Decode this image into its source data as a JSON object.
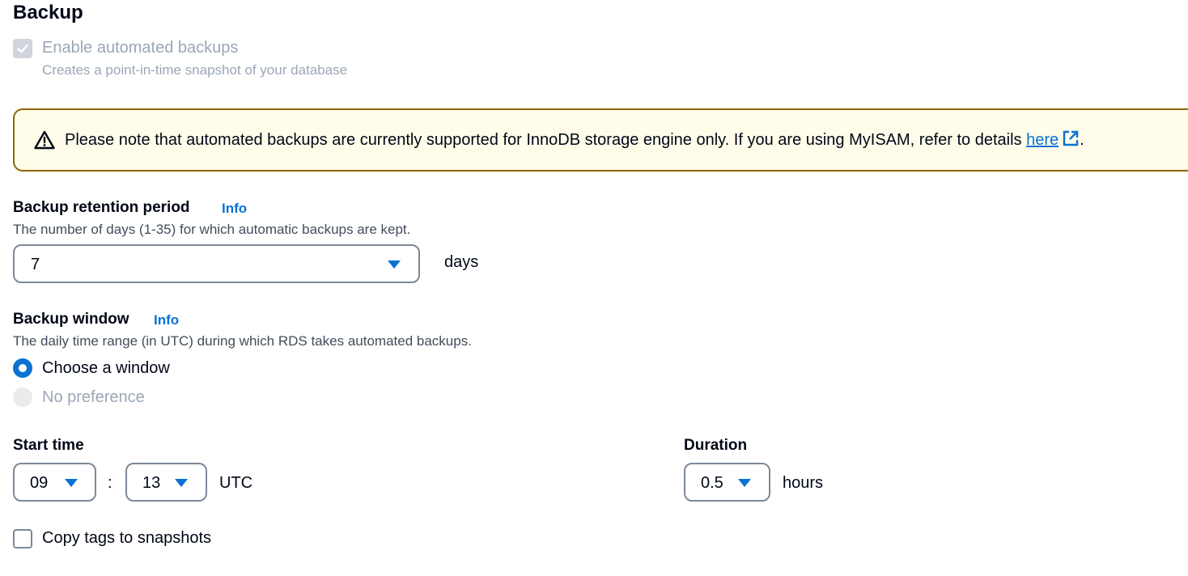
{
  "section": {
    "title": "Backup"
  },
  "automated_backups": {
    "label": "Enable automated backups",
    "description": "Creates a point-in-time snapshot of your database",
    "checked": true,
    "disabled": true
  },
  "warning": {
    "text": "Please note that automated backups are currently supported for InnoDB storage engine only. If you are using MyISAM, refer to details ",
    "link_text": "here",
    "suffix": "."
  },
  "retention": {
    "label": "Backup retention period",
    "info": "Info",
    "description": "The number of days (1-35) for which automatic backups are kept.",
    "value": "7",
    "unit": "days"
  },
  "window": {
    "label": "Backup window",
    "info": "Info",
    "description": "The daily time range (in UTC) during which RDS takes automated backups.",
    "options": [
      {
        "label": "Choose a window",
        "selected": true,
        "disabled": false
      },
      {
        "label": "No preference",
        "selected": false,
        "disabled": true
      }
    ]
  },
  "start_time": {
    "label": "Start time",
    "hour": "09",
    "separator": ":",
    "minute": "13",
    "timezone": "UTC"
  },
  "duration": {
    "label": "Duration",
    "value": "0.5",
    "unit": "hours"
  },
  "copy_tags": {
    "label": "Copy tags to snapshots",
    "checked": false
  },
  "colors": {
    "accent": "#0972d3",
    "warning_border": "#8d6605",
    "warning_bg": "#fffce9",
    "disabled_text": "#9ba7b6"
  }
}
